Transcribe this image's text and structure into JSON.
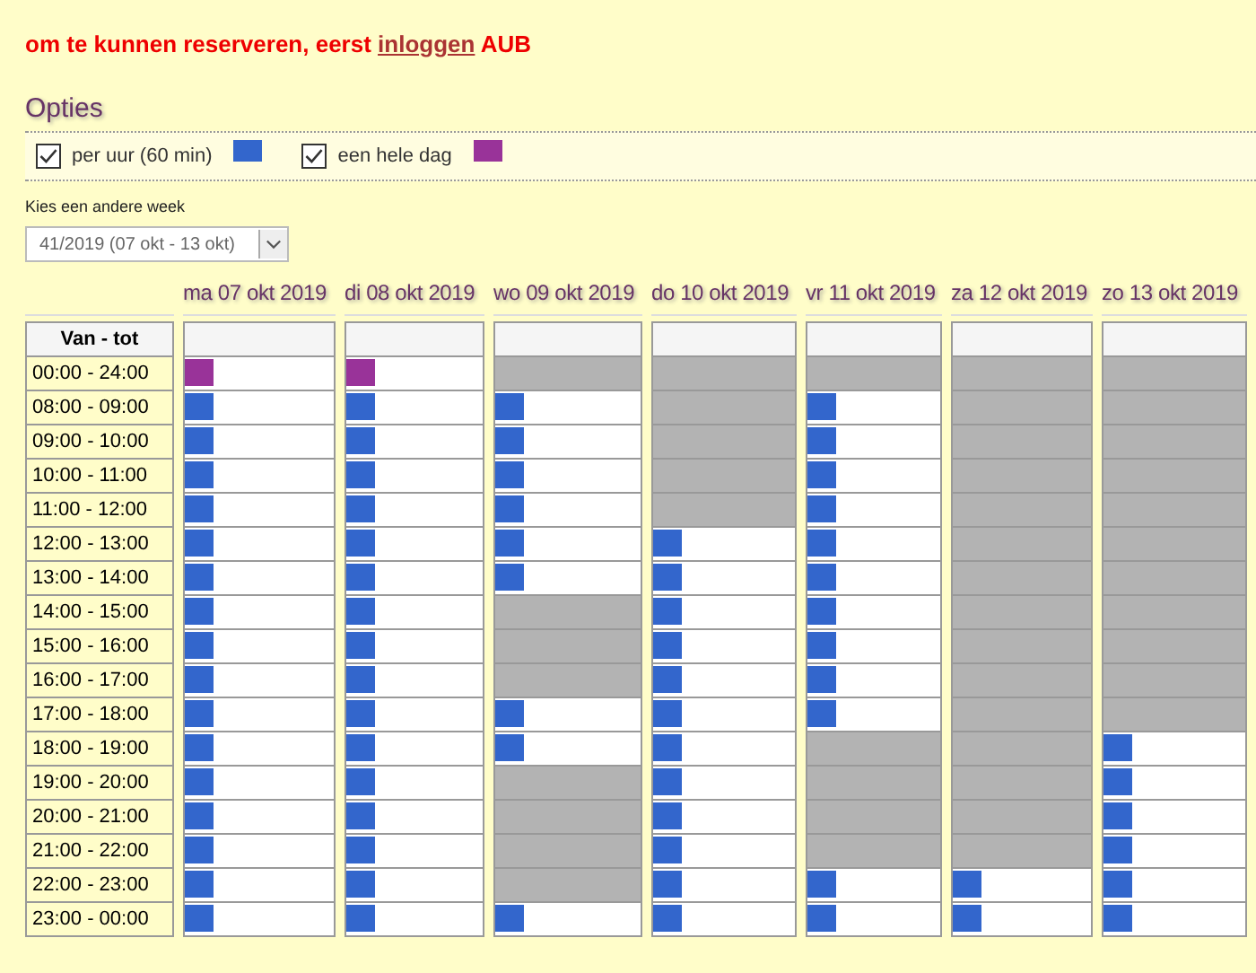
{
  "notice": {
    "text": "om te kunnen reserveren, eerst",
    "link": "inloggen",
    "suffix": "AUB"
  },
  "options_title": "Opties",
  "options": [
    {
      "label": "per uur (60 min)",
      "checked": true,
      "color": "#3366cc"
    },
    {
      "label": "een hele dag",
      "checked": true,
      "color": "#993399"
    }
  ],
  "week_label": "Kies een andere week",
  "week_select": {
    "value": "41/2019 (07 okt - 13 okt)"
  },
  "time_header": "Van - tot",
  "rows": [
    {
      "time": "00:00 - 24:00",
      "kind": "day"
    },
    {
      "time": "08:00 - 09:00",
      "kind": "hour"
    },
    {
      "time": "09:00 - 10:00",
      "kind": "hour"
    },
    {
      "time": "10:00 - 11:00",
      "kind": "hour"
    },
    {
      "time": "11:00 - 12:00",
      "kind": "hour"
    },
    {
      "time": "12:00 - 13:00",
      "kind": "hour"
    },
    {
      "time": "13:00 - 14:00",
      "kind": "hour"
    },
    {
      "time": "14:00 - 15:00",
      "kind": "hour"
    },
    {
      "time": "15:00 - 16:00",
      "kind": "hour"
    },
    {
      "time": "16:00 - 17:00",
      "kind": "hour"
    },
    {
      "time": "17:00 - 18:00",
      "kind": "hour"
    },
    {
      "time": "18:00 - 19:00",
      "kind": "hour"
    },
    {
      "time": "19:00 - 20:00",
      "kind": "hour"
    },
    {
      "time": "20:00 - 21:00",
      "kind": "hour"
    },
    {
      "time": "21:00 - 22:00",
      "kind": "hour"
    },
    {
      "time": "22:00 - 23:00",
      "kind": "hour"
    },
    {
      "time": "23:00 - 00:00",
      "kind": "hour"
    }
  ],
  "days": [
    {
      "label": "ma 07 okt 2019",
      "available": [
        true,
        true,
        true,
        true,
        true,
        true,
        true,
        true,
        true,
        true,
        true,
        true,
        true,
        true,
        true,
        true,
        true
      ]
    },
    {
      "label": "di 08 okt 2019",
      "available": [
        true,
        true,
        true,
        true,
        true,
        true,
        true,
        true,
        true,
        true,
        true,
        true,
        true,
        true,
        true,
        true,
        true
      ]
    },
    {
      "label": "wo 09 okt 2019",
      "available": [
        false,
        true,
        true,
        true,
        true,
        true,
        true,
        false,
        false,
        false,
        true,
        true,
        false,
        false,
        false,
        false,
        true
      ]
    },
    {
      "label": "do 10 okt 2019",
      "available": [
        false,
        false,
        false,
        false,
        false,
        true,
        true,
        true,
        true,
        true,
        true,
        true,
        true,
        true,
        true,
        true,
        true
      ]
    },
    {
      "label": "vr 11 okt 2019",
      "available": [
        false,
        true,
        true,
        true,
        true,
        true,
        true,
        true,
        true,
        true,
        true,
        false,
        false,
        false,
        false,
        true,
        true
      ]
    },
    {
      "label": "za 12 okt 2019",
      "available": [
        false,
        false,
        false,
        false,
        false,
        false,
        false,
        false,
        false,
        false,
        false,
        false,
        false,
        false,
        false,
        true,
        true
      ]
    },
    {
      "label": "zo 13 okt 2019",
      "available": [
        false,
        false,
        false,
        false,
        false,
        false,
        false,
        false,
        false,
        false,
        false,
        true,
        true,
        true,
        true,
        true,
        true
      ]
    }
  ]
}
